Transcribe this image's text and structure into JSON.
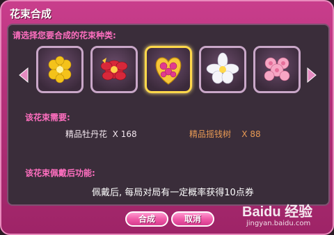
{
  "dialog": {
    "title": "花束合成",
    "prompt": "请选择您要合成的花束种类:",
    "flowers": [
      {
        "icon": "gold-flower-bouquet-icon",
        "selected": false
      },
      {
        "icon": "red-peony-bouquet-icon",
        "selected": false
      },
      {
        "icon": "heart-rose-bouquet-icon",
        "selected": true
      },
      {
        "icon": "white-lily-bouquet-icon",
        "selected": false
      },
      {
        "icon": "pink-rose-bouquet-icon",
        "selected": false
      }
    ],
    "needs_label": "该花束需要:",
    "materials": [
      {
        "name": "精品牡丹花",
        "qty": "X 168"
      },
      {
        "name": "精品摇钱树",
        "qty": "X 88"
      }
    ],
    "effect_label": "该花束佩戴后功能:",
    "effect_text": "佩戴后, 每局对局有一定概率获得10点券",
    "buttons": {
      "ok": "合成",
      "cancel": "取消"
    },
    "colors": {
      "frame": "#b4307a",
      "panel": "#3a2d3a",
      "section_label": "#ff6fc0",
      "material2": "#e89a54",
      "selected_border": "#ffd84a"
    }
  },
  "watermark": {
    "logo": "Baidu 经验",
    "url": "jingyan.baidu.com"
  }
}
